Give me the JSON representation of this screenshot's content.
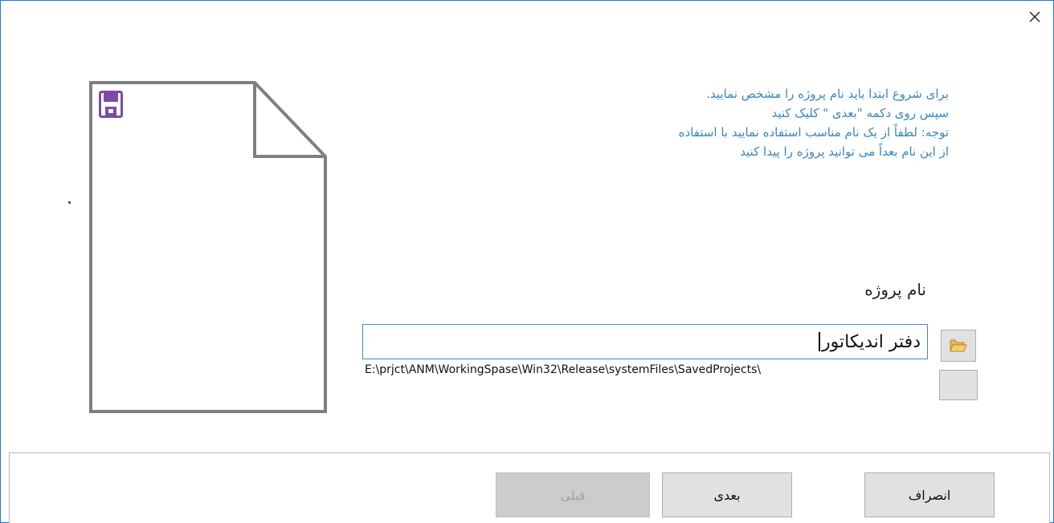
{
  "dialog": {
    "close_icon": "close-icon"
  },
  "illustration": {
    "document_icon": "document-outline-icon",
    "save_icon": "floppy-disk-icon",
    "save_icon_color": "#7b4ba6",
    "outline_color": "#808080"
  },
  "instructions": {
    "lines": [
      "برای شروع ابتدا باید نام پروژه را مشخص نمایید.",
      "سپس روی دکمه \"بعدی \" کلیک کنید",
      "توجه: لطفاً از یک نام مناسب استفاده نمایید با استفاده",
      "از این نام بعداً می توانید پروژه را پیدا کنید"
    ],
    "color": "#3a86c0"
  },
  "form": {
    "project_name_label": "نام پروژه",
    "project_name_value": "دفتر اندیکاتور",
    "path": "E:\\prjct\\ANM\\WorkingSpase\\Win32\\Release\\systemFiles\\SavedProjects\\",
    "folder_icon": "folder-open-icon"
  },
  "footer": {
    "cancel_label": "انصراف",
    "next_label": "بعدی",
    "prev_label": "قبلی"
  }
}
